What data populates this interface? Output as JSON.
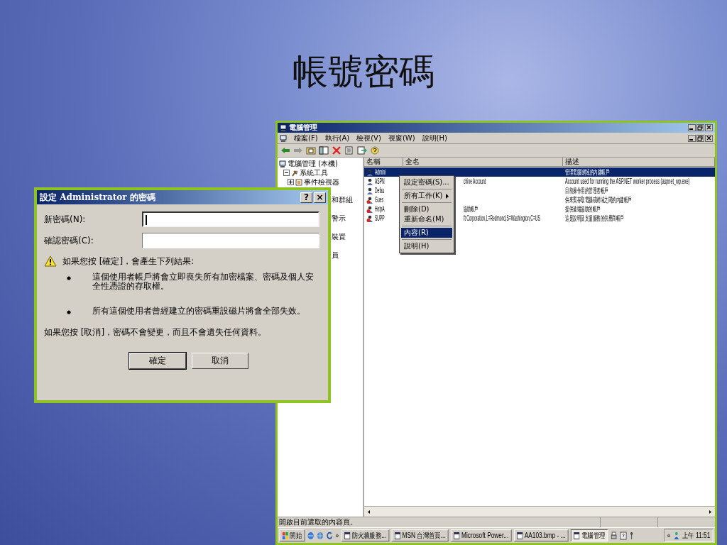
{
  "slide": {
    "title": "帳號密碼"
  },
  "main_window": {
    "title": "電腦管理",
    "menu": [
      "檔案(F)",
      "執行(A)",
      "檢視(V)",
      "視窗(W)",
      "說明(H)"
    ],
    "tree": [
      {
        "label": "電腦管理 (本機)",
        "kind": "node",
        "children": [
          {
            "label": "系統工具",
            "kind": "node",
            "expanded": true,
            "children": [
              {
                "label": "事件檢視器",
                "kind": "node",
                "expanded": false
              },
              {
                "label": "和群組",
                "kind": "partial"
              },
              {
                "label": "警示",
                "kind": "partial"
              },
              {
                "label": "裝置",
                "kind": "partial"
              },
              {
                "label": "員",
                "kind": "partial"
              }
            ]
          }
        ]
      }
    ],
    "columns": [
      "名稱",
      "全名",
      "描述"
    ],
    "rows": [
      {
        "name": "Admini",
        "full_name": "",
        "description": "管理電腦/網域的內建帳戶",
        "selected": true,
        "disabled": false
      },
      {
        "name": "ASPN",
        "full_name": "chine Account",
        "description": "Account used for running the ASP.NET worker process (aspnet_wp.exe)",
        "selected": false,
        "disabled": false
      },
      {
        "name": "Defau",
        "full_name": "",
        "description": "目前操作用的管理者帳戶",
        "selected": false,
        "disabled": false
      },
      {
        "name": "Gues",
        "full_name": "",
        "description": "供來賓存取電腦或網域之間的內建帳戶",
        "selected": false,
        "disabled": true
      },
      {
        "name": "HelpA",
        "full_name": "協助帳戶",
        "description": "提供遠端協助的帳戶",
        "selected": false,
        "disabled": true
      },
      {
        "name": "SUPP",
        "full_name": "ft Corporation,L=Redmond,S=Washington,C=US",
        "description": "這是說明及支援服務的供應商帳戶",
        "selected": false,
        "disabled": true
      }
    ],
    "context_menu": [
      {
        "kind": "item",
        "label": "設定密碼(S)...",
        "selected": false
      },
      {
        "kind": "separator"
      },
      {
        "kind": "submenu",
        "label": "所有工作(K)",
        "selected": false
      },
      {
        "kind": "separator"
      },
      {
        "kind": "item",
        "label": "刪除(D)",
        "selected": false
      },
      {
        "kind": "item",
        "label": "重新命名(M)",
        "selected": false
      },
      {
        "kind": "separator"
      },
      {
        "kind": "item",
        "label": "內容(R)",
        "selected": true
      },
      {
        "kind": "separator"
      },
      {
        "kind": "item",
        "label": "說明(H)",
        "selected": false
      }
    ],
    "status_bar": "開啟目前選取的內容頁。"
  },
  "taskbar": {
    "start": "開始",
    "overflow": "»",
    "buttons": [
      {
        "label": "防火牆服務...",
        "selected": false
      },
      {
        "label": "MSN 台灣首頁...",
        "selected": false
      },
      {
        "label": "Microsoft Power...",
        "selected": false
      },
      {
        "label": "AA103.bmp - ...",
        "selected": false
      },
      {
        "label": "電腦管理",
        "selected": true
      }
    ],
    "tray_expand": "«",
    "clock": "上午 11:51"
  },
  "dialog": {
    "title": "設定 Administrator 的密碼",
    "help": "?",
    "close": "×",
    "fields": [
      {
        "label": "新密碼(N):",
        "focused": true
      },
      {
        "label": "確認密碼(C):",
        "focused": false
      }
    ],
    "warning": "如果您按 [確定]，會產生下列結果:",
    "bullets": [
      "這個使用者帳戶將會立即喪失所有加密檔案、密碼及個人安全性憑證的存取權。",
      "所有這個使用者曾經建立的密碼重設磁片將會全部失效。"
    ],
    "note": "如果您按 [取消]，密碼不會變更，而且不會遺失任何資料。",
    "buttons": [
      {
        "label": "確定",
        "default": true
      },
      {
        "label": "取消",
        "default": false
      }
    ]
  }
}
